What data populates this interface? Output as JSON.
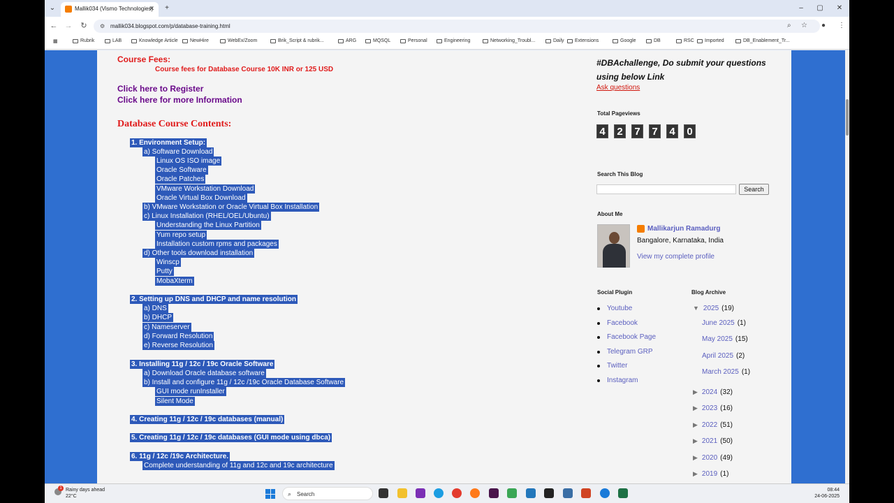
{
  "browser": {
    "tab_title": "Mallik034 (Vismo Technologies)",
    "url": "mallik034.blogspot.com/p/database-training.html",
    "bookmarks": [
      "Rubrik",
      "LAB",
      "Knowledge Article",
      "NewHire",
      "WebEx/Zoom",
      "Brik_Script & rubrik...",
      "ARG",
      "MQSQL",
      "Personal",
      "Engineering",
      "Networking_Troubl...",
      "Daily",
      "Extensions",
      "Google",
      "DB",
      "RSC",
      "Imported",
      "DB_Enablement_Tr..."
    ]
  },
  "main": {
    "fees_heading": "Course Fees:",
    "fees_detail": "Course fees for Database Course 10K INR or 125 USD",
    "register_link": "Click here to Register",
    "info_link": "Click here for more Information",
    "contents_heading": "Database Course Contents:",
    "lines": [
      "1. Environment Setup:",
      "a) Software Download",
      "Linux OS ISO image",
      "Oracle Software",
      "Oracle Patches",
      "VMware Workstation Download",
      "Oracle Virtual Box Download",
      "b) VMware Workstation or Oracle Virtual Box Installation",
      "c) Linux Installation (RHEL/OEL/Ubuntu)",
      "Understanding the Linux Partition",
      "Yum repo setup",
      "Installation custom rpms and packages",
      "d) Other tools download installation",
      "Winscp",
      "Putty",
      "MobaXterm",
      "2. Setting up DNS and DHCP and name resolution",
      "a) DNS",
      "b) DHCP",
      "c) Nameserver",
      "d) Forward Resolution",
      "e) Reverse Resolution",
      "3. Installing 11g / 12c / 19c  Oracle Software",
      "a) Download Oracle database software",
      "b) Install and configure 11g / 12c /19c Oracle Database Software",
      "GUI mode runInstaller",
      "Silent Mode",
      "4. Creating 11g / 12c / 19c databases (manual)",
      "5. Creating 11g / 12c / 19c databases (GUI mode using dbca)",
      "6. 11g / 12c /19c Architecture.",
      "Complete understanding of 11g and 12c and 19c architecture"
    ]
  },
  "sidebar": {
    "challenge": "#DBAchallenge, Do submit your questions using below Link",
    "ask_link": "Ask questions",
    "pageviews_title": "Total Pageviews",
    "pageviews_digits": [
      "4",
      "2",
      "7",
      "7",
      "4",
      "0"
    ],
    "search_title": "Search This Blog",
    "search_button": "Search",
    "about_title": "About Me",
    "author_name": "Mallikarjun Ramadurg",
    "author_location": "Bangalore, Karnataka, India",
    "profile_link": "View my complete profile",
    "social_title": "Social Plugin",
    "social_links": [
      "Youtube",
      "Facebook",
      "Facebook Page",
      "Telegram GRP",
      "Twitter",
      "Instagram"
    ],
    "archive_title": "Blog Archive",
    "archive_open": {
      "year": "2025",
      "count": "(19)"
    },
    "archive_months": [
      {
        "m": "June 2025",
        "c": "(1)"
      },
      {
        "m": "May 2025",
        "c": "(15)"
      },
      {
        "m": "April 2025",
        "c": "(2)"
      },
      {
        "m": "March 2025",
        "c": "(1)"
      }
    ],
    "archive_years": [
      {
        "y": "2024",
        "c": "(32)"
      },
      {
        "y": "2023",
        "c": "(16)"
      },
      {
        "y": "2022",
        "c": "(51)"
      },
      {
        "y": "2021",
        "c": "(50)"
      },
      {
        "y": "2020",
        "c": "(49)"
      },
      {
        "y": "2019",
        "c": "(1)"
      }
    ]
  },
  "taskbar": {
    "weather_line1": "Rainy days ahead",
    "weather_line2": "22°C",
    "weather_badge": "1",
    "search_placeholder": "Search",
    "time": "08:44",
    "date": "24-06-2025"
  }
}
